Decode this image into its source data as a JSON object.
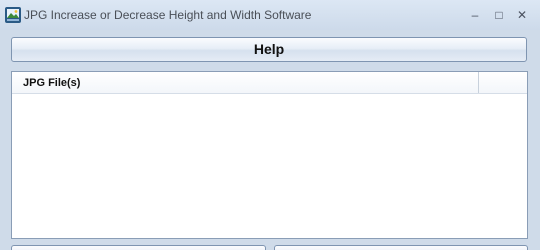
{
  "window": {
    "title": "JPG Increase or Decrease Height and Width Software",
    "controls": {
      "minimize": "–",
      "maximize": "□",
      "close": "✕"
    }
  },
  "toolbar": {
    "help_label": "Help"
  },
  "file_list": {
    "columns": [
      "JPG File(s)"
    ],
    "rows": []
  },
  "icons": {
    "app": "app-image-icon"
  },
  "colors": {
    "window_background": "#cfdbe9",
    "list_background": "#ffffff",
    "border": "#7f95b1"
  }
}
